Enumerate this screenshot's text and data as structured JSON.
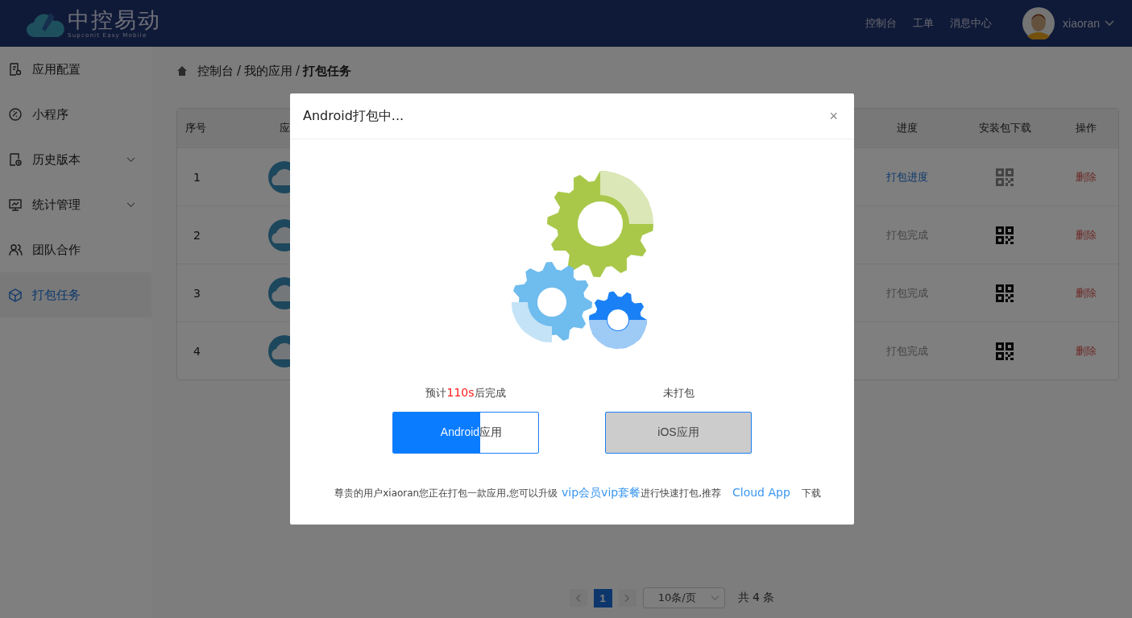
{
  "header": {
    "logo_title": "中控易动",
    "logo_subtitle": "Supconit Easy Mobile",
    "nav": [
      "控制台",
      "工单",
      "消息中心"
    ],
    "user": "xiaoran"
  },
  "sidebar": {
    "items": [
      {
        "label": "应用配置",
        "selected": false,
        "expandable": false
      },
      {
        "label": "小程序",
        "selected": false,
        "expandable": false
      },
      {
        "label": "历史版本",
        "selected": false,
        "expandable": true
      },
      {
        "label": "统计管理",
        "selected": false,
        "expandable": true
      },
      {
        "label": "团队合作",
        "selected": false,
        "expandable": false
      },
      {
        "label": "打包任务",
        "selected": true,
        "expandable": false
      }
    ]
  },
  "breadcrumb": {
    "items": [
      "控制台",
      "我的应用",
      "打包任务"
    ],
    "separator": "/"
  },
  "table": {
    "columns": [
      "序号",
      "应",
      "进度",
      "安装包下载",
      "操作"
    ],
    "rows": [
      {
        "index": "1",
        "progress": "打包进度",
        "done": false,
        "action": "删除"
      },
      {
        "index": "2",
        "progress": "打包完成",
        "done": true,
        "action": "删除"
      },
      {
        "index": "3",
        "progress": "打包完成",
        "done": true,
        "action": "删除"
      },
      {
        "index": "4",
        "progress": "打包完成",
        "done": true,
        "action": "删除"
      }
    ]
  },
  "pagination": {
    "pages": [
      {
        "label": "1",
        "selected": true
      }
    ],
    "page_size": "10条/页",
    "total": "共 4 条"
  },
  "dialog": {
    "title": "Android打包中...",
    "close": "×",
    "builds": [
      {
        "kind": "building",
        "status_parts": [
          "预计",
          "110s",
          "后完成"
        ],
        "button": "Android应用",
        "level": 0.6
      },
      {
        "kind": "idle",
        "status_parts": [
          "未打包"
        ],
        "button": "iOS应用"
      }
    ],
    "footer": {
      "text": "尊贵的用户xiaoran您正在打包一款应用,您可以升级",
      "links": [
        "vip会员",
        "vip套餐"
      ],
      "text2": "进行快速打包,推荐",
      "link3": "Cloud App",
      "text3": "下载"
    }
  }
}
